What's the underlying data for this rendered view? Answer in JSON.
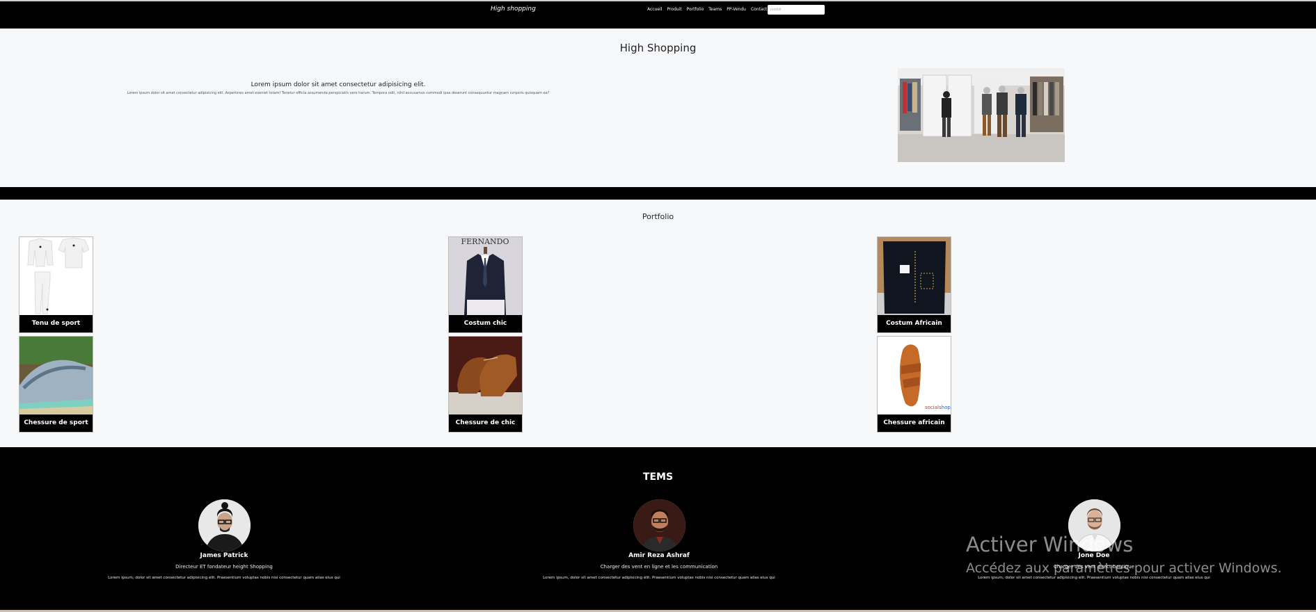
{
  "navbar": {
    "brand": "High shopping",
    "links": [
      "Accueil",
      "Produit",
      "Portfolio",
      "Teams",
      "PP-Vendu",
      "Contact"
    ],
    "search_placeholder": "produit"
  },
  "hero": {
    "title": "High Shopping",
    "subtitle": "Lorem ipsum dolor sit amet consectetur adipisicing elit.",
    "text": "Lorem ipsum dolor sit amet consectetur adipisicing elit. Asperiores amet eveniet totam! Tenetur officia assumenda perspiciatis vero harum. Tempora odit, nihil accusamus commodi ipsa deserunt consequuntur magnam corporis quisquam ea?"
  },
  "portfolio": {
    "title": "Portfolio",
    "items": [
      {
        "label": "Tenu de sport"
      },
      {
        "label": "Costum chic"
      },
      {
        "label": "Costum Africain"
      },
      {
        "label": "Chessure de sport"
      },
      {
        "label": "Chessure de chic"
      },
      {
        "label": "Chessure africain"
      }
    ]
  },
  "teams": {
    "title": "TEMS",
    "members": [
      {
        "name": "James Patrick",
        "role": "Directeur ET fondateur height Shopping",
        "text": "Lorem ipsum, dolor sit amet consectetur adipisicing elit. Praesentium voluptas nobis nisi consectetur quam alias eius qui"
      },
      {
        "name": "Amir Reza Ashraf",
        "role": "Charger des vent en ligne et les communication",
        "text": "Lorem ipsum, dolor sit amet consectetur adipisicing elit. Praesentium voluptas nobis nisi consectetur quam alias eius qui"
      },
      {
        "name": "Jone Doe",
        "role": "Charger des vent direct boutique",
        "text": "Lorem ipsum, dolor sit amet consectetur adipisicing elit. Praesentium voluptas nobis nisi consectetur quam alias eius qui"
      }
    ]
  },
  "watermark": {
    "line1": "Activer Windows",
    "line2": "Accédez aux paramètres pour activer Windows."
  }
}
